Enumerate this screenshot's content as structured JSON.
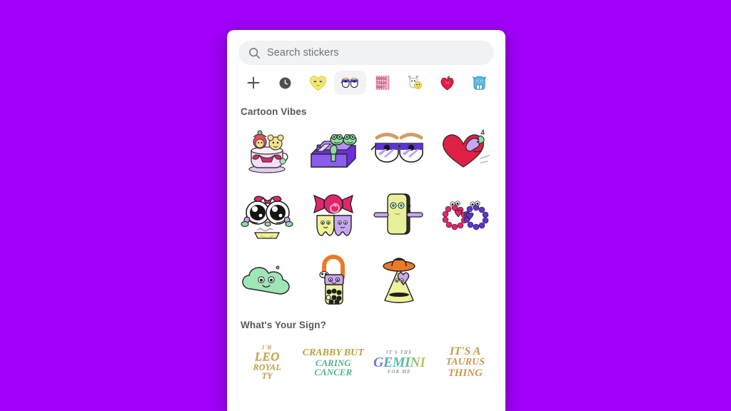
{
  "theme": {
    "background_color": "#a200fa",
    "panel_color": "#ffffff",
    "search_bar_color": "#f1f2f4",
    "selected_tab_color": "#f2f3f5",
    "text_color": "#55595f",
    "placeholder_color": "#6e7278"
  },
  "search": {
    "placeholder": "Search stickers",
    "value": "",
    "icon": "search-icon"
  },
  "tabs": [
    {
      "id": "add",
      "icon": "plus-icon",
      "label": "Add stickers",
      "selected": false
    },
    {
      "id": "recent",
      "icon": "clock-icon",
      "label": "Recently used",
      "selected": false
    },
    {
      "id": "yellow-heart",
      "icon": "yellow-heart-face-sticker-icon",
      "label": "Yellow Heart Pack",
      "selected": false
    },
    {
      "id": "cartoon-vibes",
      "icon": "cartoon-eyes-sticker-icon",
      "label": "Cartoon Vibes",
      "selected": true
    },
    {
      "id": "pink-stripes",
      "icon": "pink-striped-text-sticker-icon",
      "label": "Pink Text Pack",
      "selected": false
    },
    {
      "id": "white-yellow-char",
      "icon": "white-yellow-character-sticker-icon",
      "label": "Character Pack",
      "selected": false
    },
    {
      "id": "red-apple",
      "icon": "red-apple-heart-sticker-icon",
      "label": "Red Apple Pack",
      "selected": false
    },
    {
      "id": "blue-frog",
      "icon": "blue-frog-sticker-icon",
      "label": "Blue Frog Pack",
      "selected": false
    }
  ],
  "sections": [
    {
      "id": "cartoon-vibes",
      "title": "Cartoon Vibes",
      "stickers": [
        {
          "id": "teacup-dolls",
          "name": "teacup-with-dolls-sticker"
        },
        {
          "id": "frog-bed",
          "name": "frogs-on-purple-bed-sticker"
        },
        {
          "id": "eyes-sunglasses",
          "name": "purple-eyes-sunglasses-sticker"
        },
        {
          "id": "heart-unicorn",
          "name": "red-heart-with-unicorn-sticker"
        },
        {
          "id": "bow-eyes-face",
          "name": "big-eyes-with-red-bow-sticker"
        },
        {
          "id": "candy-teeth",
          "name": "candy-and-two-teeth-sticker"
        },
        {
          "id": "phone-face",
          "name": "green-phone-with-face-sticker"
        },
        {
          "id": "beaded-bracelets",
          "name": "beaded-heart-bracelets-sticker"
        },
        {
          "id": "green-cloud",
          "name": "green-smiling-cloud-sticker"
        },
        {
          "id": "boba-straw",
          "name": "boba-drink-with-straw-sticker"
        },
        {
          "id": "ghost-hat",
          "name": "yellow-ghost-with-hat-sticker"
        }
      ]
    },
    {
      "id": "whats-your-sign",
      "title": "What's Your Sign?",
      "stickers": [
        {
          "id": "leo",
          "name": "leo-royalty-word-art-sticker",
          "lines": [
            "I'M",
            "LEO",
            "ROYAL",
            "TY"
          ]
        },
        {
          "id": "cancer",
          "name": "crabby-but-caring-cancer-word-art-sticker",
          "lines": [
            "CRABBY BUT",
            "CARING CANCER"
          ]
        },
        {
          "id": "gemini",
          "name": "gemini-for-me-word-art-sticker",
          "lines": [
            "IT'S THE",
            "GEMINI",
            "FOR ME"
          ]
        },
        {
          "id": "taurus",
          "name": "its-a-taurus-thing-word-art-sticker",
          "lines": [
            "IT'S A",
            "TAURUS",
            "THING"
          ]
        }
      ]
    }
  ]
}
